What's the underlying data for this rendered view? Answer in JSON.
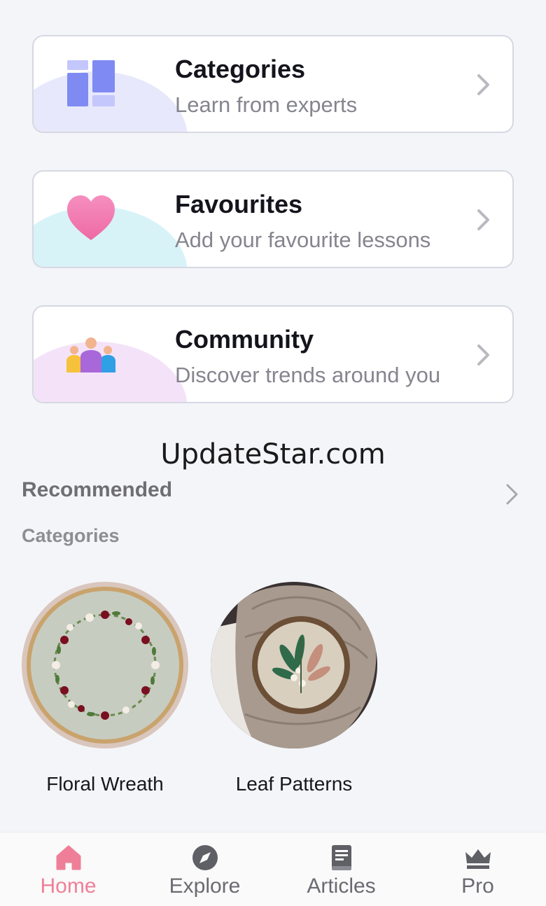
{
  "cards": [
    {
      "title": "Categories",
      "subtitle": "Learn from experts",
      "icon": "grid-icon"
    },
    {
      "title": "Favourites",
      "subtitle": "Add your favourite lessons",
      "icon": "heart-icon"
    },
    {
      "title": "Community",
      "subtitle": "Discover trends around you",
      "icon": "people-icon"
    }
  ],
  "watermark": "UpdateStar.com",
  "recommended": {
    "title": "Recommended",
    "subtitle": "Categories",
    "items": [
      {
        "label": "Floral Wreath"
      },
      {
        "label": "Leaf Patterns"
      }
    ]
  },
  "tabbar": {
    "active": "Home",
    "tabs": [
      {
        "label": "Home",
        "icon": "home-icon"
      },
      {
        "label": "Explore",
        "icon": "compass-icon"
      },
      {
        "label": "Articles",
        "icon": "book-icon"
      },
      {
        "label": "Pro",
        "icon": "crown-icon"
      }
    ]
  },
  "colors": {
    "accent": "#ef7f98",
    "background": "#f4f5f9",
    "card_border": "#d6d8e2"
  }
}
